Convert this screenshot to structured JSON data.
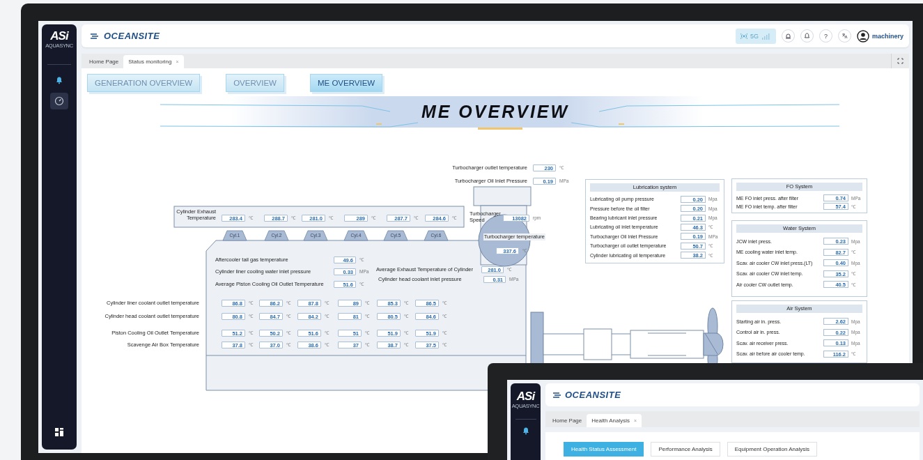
{
  "logo": {
    "mark": "ASi",
    "subtitle": "AQUASYNC"
  },
  "sidebar": {
    "items": [
      {
        "selected": false
      },
      {
        "selected": true
      }
    ]
  },
  "header": {
    "brand": "OCEANSITE",
    "network": "5G",
    "help": "?",
    "user": "machinery"
  },
  "tabs": [
    {
      "label": "Home Page",
      "selected": false
    },
    {
      "label": "Status monitoring",
      "selected": true,
      "close": "×"
    }
  ],
  "view_buttons": [
    {
      "label": "GENERATION OVERVIEW",
      "selected": false
    },
    {
      "label": "OVERVIEW",
      "selected": false
    },
    {
      "label": "ME OVERVIEW",
      "selected": true
    }
  ],
  "title": "ME OVERVIEW",
  "turbocharger": {
    "readings": [
      {
        "label": "Turbocharger outlet temperature",
        "value": "230",
        "unit": "℃"
      },
      {
        "label": "Turbocharger Oil Inlet Pressure",
        "value": "0.19",
        "unit": "MPa"
      }
    ],
    "speed": {
      "label": "Turbocharger Speed",
      "value": "13082",
      "unit": "rpm"
    },
    "temperature": {
      "label": "Turbocharger temperature",
      "value": "337.6",
      "unit": "℃"
    }
  },
  "exhaust": {
    "label": "Cylinder Exhaust Temperature",
    "values": [
      "283.4",
      "288.7",
      "281.0",
      "289",
      "287.7",
      "284.6"
    ],
    "unit": "℃"
  },
  "cylinders": [
    "Cyl.1",
    "Cyl.2",
    "Cyl.3",
    "Cyl.4",
    "Cyl.5",
    "Cyl.6"
  ],
  "engine_readings": [
    {
      "label": "Aftercooler tail gas temperature",
      "value": "49.6",
      "unit": "℃"
    },
    {
      "label": "Cylinder liner cooling water inlet pressure",
      "value": "0.33",
      "unit": "MPa"
    },
    {
      "label": "Average Piston Cooling Oil Outlet Temperature",
      "value": "51.6",
      "unit": "℃"
    },
    {
      "label": "Average Exhaust Temperature of Cylinder",
      "value": "281.0",
      "unit": "℃"
    },
    {
      "label": "Cylinder head coolant inlet pressure",
      "value": "0.31",
      "unit": "MPa"
    }
  ],
  "cylinder_rows": [
    {
      "label": "Cylinder liner coolant outlet temperature",
      "values": [
        "86.8",
        "86.2",
        "87.8",
        "89",
        "85.3",
        "86.5"
      ],
      "unit": "℃"
    },
    {
      "label": "Cylinder head coolant outlet temperature",
      "values": [
        "80.8",
        "84.7",
        "84.2",
        "81",
        "80.5",
        "84.6"
      ],
      "unit": "℃"
    },
    {
      "label": "Piston Cooling Oil Outlet Temperature",
      "values": [
        "51.2",
        "50.2",
        "51.6",
        "51",
        "51.9",
        "51.9"
      ],
      "unit": "℃"
    },
    {
      "label": "Scavenge Air Box Temperature",
      "values": [
        "37.8",
        "37.0",
        "38.6",
        "37",
        "38.7",
        "37.5"
      ],
      "unit": "℃"
    }
  ],
  "panels": [
    {
      "title": "Lubrication system",
      "rows": [
        {
          "label": "Lubricating oil pump pressure",
          "value": "0.20",
          "unit": "Mpa"
        },
        {
          "label": "Pressure before the oil filter",
          "value": "0.20",
          "unit": "Mpa"
        },
        {
          "label": "Bearing lubricant inlet pressure",
          "value": "0.21",
          "unit": "Mpa"
        },
        {
          "label": "Lubricating oil inlet temperature",
          "value": "46.3",
          "unit": "℃"
        },
        {
          "label": "Turbocharger Oil Inlet Pressure",
          "value": "0.19",
          "unit": "MPa"
        },
        {
          "label": "Turbocharger oil outlet temperature",
          "value": "50.7",
          "unit": "℃"
        },
        {
          "label": "Cylinder lubricating oil temperature",
          "value": "38.2",
          "unit": "℃"
        }
      ]
    },
    {
      "title": "FO System",
      "rows": [
        {
          "label": "ME FO inlet press. after filter",
          "value": "0.74",
          "unit": "MPa"
        },
        {
          "label": "ME FO inlet temp. after filter",
          "value": "57.4",
          "unit": "℃"
        }
      ]
    },
    {
      "title": "Water System",
      "rows": [
        {
          "label": "JCW inlet press.",
          "value": "0.23",
          "unit": "Mpa"
        },
        {
          "label": "ME cooling water inlet temp.",
          "value": "82.7",
          "unit": "℃"
        },
        {
          "label": "Scav. air cooler CW inlet press.(LT)",
          "value": "0.40",
          "unit": "Mpa"
        },
        {
          "label": "Scav. air cooler CW inlet temp.",
          "value": "35.2",
          "unit": "℃"
        },
        {
          "label": "Air cooler CW outlet temp.",
          "value": "40.5",
          "unit": "℃"
        }
      ]
    },
    {
      "title": "Air System",
      "rows": [
        {
          "label": "Starting air in. press.",
          "value": "2.62",
          "unit": "Mpa"
        },
        {
          "label": "Control air in. press.",
          "value": "0.22",
          "unit": "Mpa"
        },
        {
          "label": "Scav. air receiver press.",
          "value": "0.13",
          "unit": "Mpa"
        },
        {
          "label": "Scav. air before air cooler temp.",
          "value": "116.2",
          "unit": "℃"
        }
      ]
    }
  ],
  "second_window": {
    "logo": {
      "mark": "ASi",
      "subtitle": "AQUASYNC"
    },
    "brand": "OCEANSITE",
    "tabs": [
      {
        "label": "Home Page",
        "selected": false
      },
      {
        "label": "Health Analysis",
        "selected": true,
        "close": "×"
      }
    ],
    "buttons": [
      {
        "label": "Health Status Assessment",
        "selected": true
      },
      {
        "label": "Performance Analysis",
        "selected": false
      },
      {
        "label": "Equipment Operation Analysis",
        "selected": false
      }
    ]
  }
}
